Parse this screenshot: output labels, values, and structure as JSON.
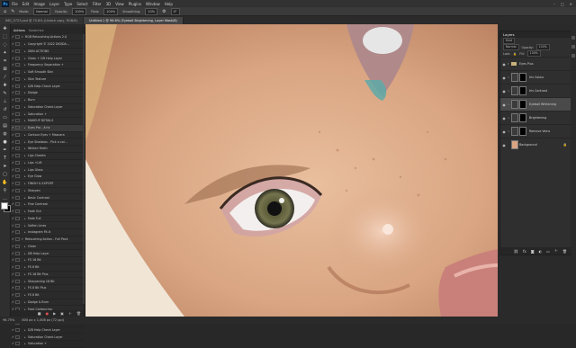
{
  "menu": {
    "app_icon": "Ps",
    "items": [
      "File",
      "Edit",
      "Image",
      "Layer",
      "Type",
      "Select",
      "Filter",
      "3D",
      "View",
      "Plugins",
      "Window",
      "Help"
    ]
  },
  "options_bar": {
    "mode_label": "Mode:",
    "mode_value": "Normal",
    "opacity_label": "Opacity:",
    "opacity_value": "100%",
    "flow_label": "Flow:",
    "flow_value": "100%",
    "smoothing_label": "Smoothing:",
    "smoothing_value": "10%",
    "angle_value": "0°"
  },
  "tabs": [
    {
      "label": "IMG_5723.psd @ 75.6% (Unlock copy, RGB/8)"
    },
    {
      "label": "Untitled-1 @ 96.6% (Eyeball Brightening, Layer Mask/8)"
    }
  ],
  "actions_panel": {
    "tab_actions": "Actions",
    "tab_swatches": "Swatches",
    "rows": [
      {
        "label": "RGB Retouching Actions 2.0",
        "indent": 0,
        "open": true
      },
      {
        "label": "Copyright © 2022 DIGIDA...",
        "indent": 1
      },
      {
        "label": "SKIN ACTIONS",
        "indent": 1
      },
      {
        "label": "Clean + Dft Help Layer",
        "indent": 1
      },
      {
        "label": "Frequency Separation +",
        "indent": 1
      },
      {
        "label": "Soft Smooth Skin",
        "indent": 1
      },
      {
        "label": "Skin Texture",
        "indent": 1
      },
      {
        "label": "D/B Help Check Layer",
        "indent": 1
      },
      {
        "label": "Dodge",
        "indent": 1
      },
      {
        "label": "Burn",
        "indent": 1
      },
      {
        "label": "Saturation Check Layer",
        "indent": 1
      },
      {
        "label": "Saturation +",
        "indent": 1
      },
      {
        "label": "MAKEUP DETAILS",
        "indent": 1
      },
      {
        "label": "Eyes Pro - A+a",
        "indent": 1,
        "selected": true
      },
      {
        "label": "Contour Eyes + Mascara",
        "indent": 1
      },
      {
        "label": "Eye Shadows - Pick a col...",
        "indent": 1
      },
      {
        "label": "Whiten Teeth",
        "indent": 1
      },
      {
        "label": "Lips Cheeks",
        "indent": 1
      },
      {
        "label": "Lips +Lift",
        "indent": 1
      },
      {
        "label": "Lips Gloss",
        "indent": 1
      },
      {
        "label": "Eye Glow",
        "indent": 1
      },
      {
        "label": "FINISH & EXPORT",
        "indent": 1
      },
      {
        "label": "Sharpen",
        "indent": 1
      },
      {
        "label": "Basic Contrast",
        "indent": 1
      },
      {
        "label": "Fine Contrast",
        "indent": 1
      },
      {
        "label": "Fade Out",
        "indent": 1
      },
      {
        "label": "Fade Full",
        "indent": 1
      },
      {
        "label": "Soften Lines",
        "indent": 1
      },
      {
        "label": "Instagram Fit-It",
        "indent": 1
      },
      {
        "label": "Retouching Action - Full Pack",
        "indent": 0,
        "open": true
      },
      {
        "label": "Clean",
        "indent": 1
      },
      {
        "label": "DB Help Layer",
        "indent": 1
      },
      {
        "label": "FS 16 Bit",
        "indent": 1
      },
      {
        "label": "FS 8 Bit",
        "indent": 1
      },
      {
        "label": "FS 16 Bit Plus",
        "indent": 1
      },
      {
        "label": "Sharpening 16 Bit",
        "indent": 1
      },
      {
        "label": "FS 8 Bit Plus",
        "indent": 1
      },
      {
        "label": "FS 8 Bit",
        "indent": 1
      },
      {
        "label": "Dodge & Burn",
        "indent": 1
      },
      {
        "label": "Face Contouring",
        "indent": 1
      },
      {
        "label": "FS - Digital Skin Texture",
        "indent": 1
      },
      {
        "label": "Action 17",
        "indent": 1
      },
      {
        "label": "D/B Help Check Layer",
        "indent": 1
      },
      {
        "label": "Saturation Check Layer",
        "indent": 1
      },
      {
        "label": "Saturation +",
        "indent": 1
      }
    ]
  },
  "layers_panel": {
    "title": "Layers",
    "filter_kind": "Kind",
    "blend_mode": "Normal",
    "opacity_label": "Opacity:",
    "opacity_value": "100%",
    "lock_label": "Lock:",
    "fill_label": "Fill:",
    "fill_value": "100%",
    "layers": [
      {
        "name": "Eyes Plus",
        "group": true
      },
      {
        "name": "Iris Colour",
        "selected": false
      },
      {
        "name": "Iris Contrast",
        "selected": false
      },
      {
        "name": "Eyeball Whitening",
        "selected": true
      },
      {
        "name": "Brightening",
        "selected": false
      },
      {
        "name": "Remove Veins",
        "selected": false
      },
      {
        "name": "Background",
        "selected": false,
        "is_background": true
      }
    ]
  },
  "status_bar": {
    "zoom": "96.75%",
    "doc_size": "800 px x 1,008 px (72 ppi)"
  },
  "colors": {
    "app_bg": "#282828",
    "panel_bg": "#2f2f2f",
    "selected_row": "#4a4a4a",
    "accent": "#31a8ff"
  }
}
